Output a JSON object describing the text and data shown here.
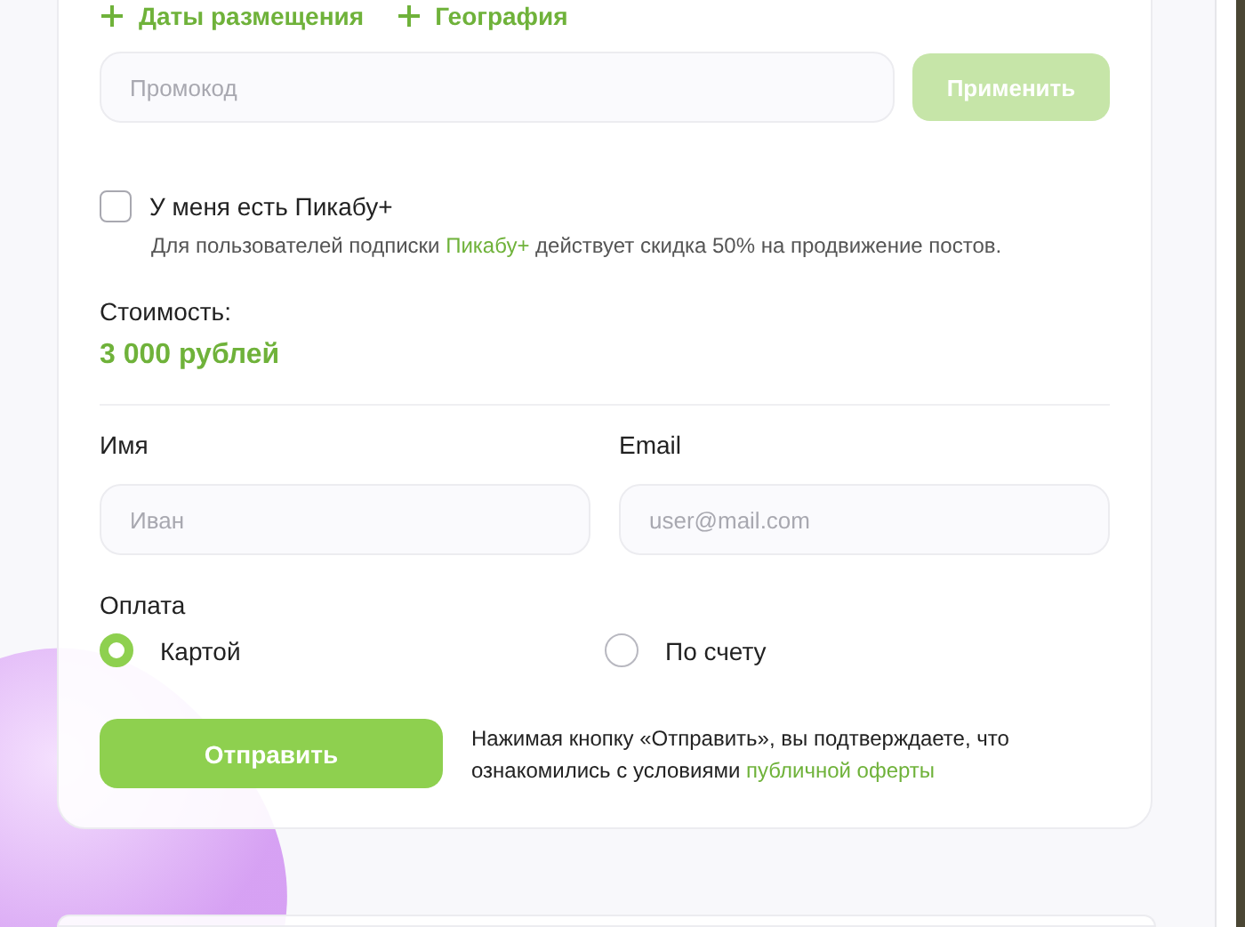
{
  "filters": [
    {
      "label": "Даты размещения"
    },
    {
      "label": "География"
    }
  ],
  "promo": {
    "placeholder": "Промокод",
    "button": {
      "label": "Применить",
      "disabled": true
    }
  },
  "subscription": {
    "label": "У меня есть Пикабу+",
    "checked": false,
    "note": "Для пользователей подписки **Пикабу+** действует скидка 50% на продвижение постов."
  },
  "cost": {
    "label": "Стоимость:",
    "value": "3 000 рублей"
  },
  "fields": [
    {
      "label": "Имя",
      "placeholder": "Иван"
    },
    {
      "label": "Email",
      "placeholder": "user@mail.com"
    }
  ],
  "payment": {
    "label": "Оплата",
    "options": [
      {
        "label": "Картой",
        "selected": true
      },
      {
        "label": "По счету",
        "selected": false
      }
    ]
  },
  "submit": {
    "label": "Отправить"
  },
  "consent": {
    "text": "Нажимая кнопку «Отправить», вы подтверждаете, что ознакомились с условиями ",
    "link": "публичной оферты"
  }
}
